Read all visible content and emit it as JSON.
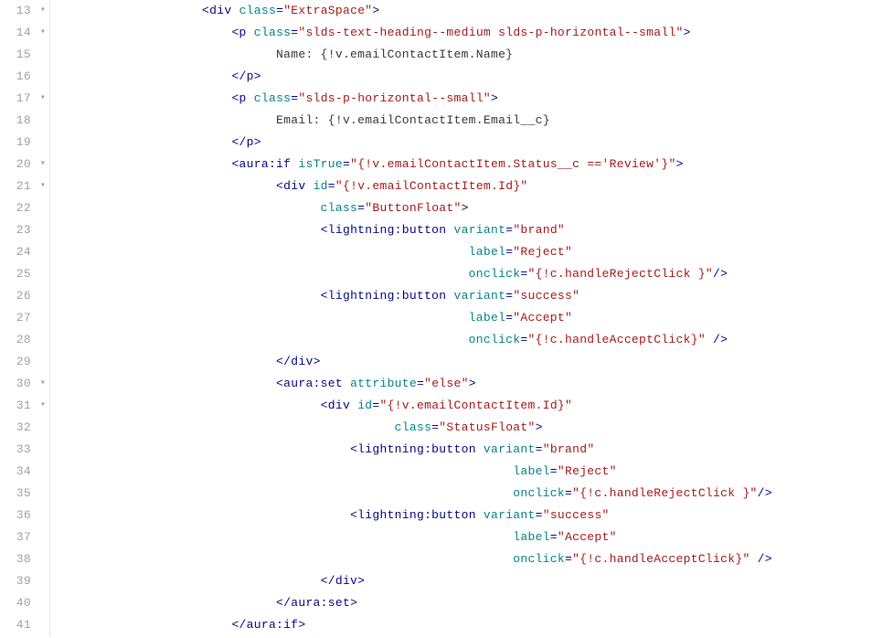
{
  "lines": [
    {
      "num": "13",
      "fold": "▾",
      "indent": 20,
      "tokens": [
        {
          "t": "pun",
          "v": "<"
        },
        {
          "t": "tag",
          "v": "div"
        },
        {
          "t": "text",
          "v": " "
        },
        {
          "t": "attr",
          "v": "class"
        },
        {
          "t": "pun",
          "v": "="
        },
        {
          "t": "str",
          "v": "\"ExtraSpace\""
        },
        {
          "t": "pun",
          "v": ">"
        }
      ]
    },
    {
      "num": "14",
      "fold": "▾",
      "indent": 24,
      "tokens": [
        {
          "t": "pun",
          "v": "<"
        },
        {
          "t": "tag",
          "v": "p"
        },
        {
          "t": "text",
          "v": " "
        },
        {
          "t": "attr",
          "v": "class"
        },
        {
          "t": "pun",
          "v": "="
        },
        {
          "t": "str",
          "v": "\"slds-text-heading--medium slds-p-horizontal--small\""
        },
        {
          "t": "pun",
          "v": ">"
        }
      ]
    },
    {
      "num": "15",
      "fold": "",
      "indent": 30,
      "tokens": [
        {
          "t": "text",
          "v": "Name: {!v.emailContactItem.Name}"
        }
      ]
    },
    {
      "num": "16",
      "fold": "",
      "indent": 24,
      "tokens": [
        {
          "t": "pun",
          "v": "</"
        },
        {
          "t": "tag",
          "v": "p"
        },
        {
          "t": "pun",
          "v": ">"
        }
      ]
    },
    {
      "num": "17",
      "fold": "▾",
      "indent": 24,
      "tokens": [
        {
          "t": "pun",
          "v": "<"
        },
        {
          "t": "tag",
          "v": "p"
        },
        {
          "t": "text",
          "v": " "
        },
        {
          "t": "attr",
          "v": "class"
        },
        {
          "t": "pun",
          "v": "="
        },
        {
          "t": "str",
          "v": "\"slds-p-horizontal--small\""
        },
        {
          "t": "pun",
          "v": ">"
        }
      ]
    },
    {
      "num": "18",
      "fold": "",
      "indent": 30,
      "tokens": [
        {
          "t": "text",
          "v": "Email: {!v.emailContactItem.Email__c}"
        }
      ]
    },
    {
      "num": "19",
      "fold": "",
      "indent": 24,
      "tokens": [
        {
          "t": "pun",
          "v": "</"
        },
        {
          "t": "tag",
          "v": "p"
        },
        {
          "t": "pun",
          "v": ">"
        }
      ]
    },
    {
      "num": "20",
      "fold": "▾",
      "indent": 24,
      "tokens": [
        {
          "t": "pun",
          "v": "<"
        },
        {
          "t": "tag",
          "v": "aura:if"
        },
        {
          "t": "text",
          "v": " "
        },
        {
          "t": "attr",
          "v": "isTrue"
        },
        {
          "t": "pun",
          "v": "="
        },
        {
          "t": "str",
          "v": "\"{!v.emailContactItem.Status__c =='Review'}\""
        },
        {
          "t": "pun",
          "v": ">"
        }
      ]
    },
    {
      "num": "21",
      "fold": "▾",
      "indent": 30,
      "tokens": [
        {
          "t": "pun",
          "v": "<"
        },
        {
          "t": "tag",
          "v": "div"
        },
        {
          "t": "text",
          "v": " "
        },
        {
          "t": "attr",
          "v": "id"
        },
        {
          "t": "pun",
          "v": "="
        },
        {
          "t": "str",
          "v": "\"{!v.emailContactItem.Id}\""
        }
      ]
    },
    {
      "num": "22",
      "fold": "",
      "indent": 36,
      "tokens": [
        {
          "t": "attr",
          "v": "class"
        },
        {
          "t": "pun",
          "v": "="
        },
        {
          "t": "str",
          "v": "\"ButtonFloat\""
        },
        {
          "t": "pun",
          "v": ">"
        }
      ]
    },
    {
      "num": "23",
      "fold": "",
      "indent": 36,
      "tokens": [
        {
          "t": "pun",
          "v": "<"
        },
        {
          "t": "tag",
          "v": "lightning:button"
        },
        {
          "t": "text",
          "v": " "
        },
        {
          "t": "attr",
          "v": "variant"
        },
        {
          "t": "pun",
          "v": "="
        },
        {
          "t": "str",
          "v": "\"brand\""
        }
      ]
    },
    {
      "num": "24",
      "fold": "",
      "indent": 56,
      "tokens": [
        {
          "t": "attr",
          "v": "label"
        },
        {
          "t": "pun",
          "v": "="
        },
        {
          "t": "str",
          "v": "\"Reject\""
        }
      ]
    },
    {
      "num": "25",
      "fold": "",
      "indent": 56,
      "tokens": [
        {
          "t": "attr",
          "v": "onclick"
        },
        {
          "t": "pun",
          "v": "="
        },
        {
          "t": "str",
          "v": "\"{!c.handleRejectClick }\""
        },
        {
          "t": "pun",
          "v": "/>"
        }
      ]
    },
    {
      "num": "26",
      "fold": "",
      "indent": 36,
      "tokens": [
        {
          "t": "pun",
          "v": "<"
        },
        {
          "t": "tag",
          "v": "lightning:button"
        },
        {
          "t": "text",
          "v": " "
        },
        {
          "t": "attr",
          "v": "variant"
        },
        {
          "t": "pun",
          "v": "="
        },
        {
          "t": "str",
          "v": "\"success\""
        }
      ]
    },
    {
      "num": "27",
      "fold": "",
      "indent": 56,
      "tokens": [
        {
          "t": "attr",
          "v": "label"
        },
        {
          "t": "pun",
          "v": "="
        },
        {
          "t": "str",
          "v": "\"Accept\""
        }
      ]
    },
    {
      "num": "28",
      "fold": "",
      "indent": 56,
      "tokens": [
        {
          "t": "attr",
          "v": "onclick"
        },
        {
          "t": "pun",
          "v": "="
        },
        {
          "t": "str",
          "v": "\"{!c.handleAcceptClick}\""
        },
        {
          "t": "text",
          "v": " "
        },
        {
          "t": "pun",
          "v": "/>"
        }
      ]
    },
    {
      "num": "29",
      "fold": "",
      "indent": 30,
      "tokens": [
        {
          "t": "pun",
          "v": "</"
        },
        {
          "t": "tag",
          "v": "div"
        },
        {
          "t": "pun",
          "v": ">"
        }
      ]
    },
    {
      "num": "30",
      "fold": "▾",
      "indent": 30,
      "tokens": [
        {
          "t": "pun",
          "v": "<"
        },
        {
          "t": "tag",
          "v": "aura:set"
        },
        {
          "t": "text",
          "v": " "
        },
        {
          "t": "attr",
          "v": "attribute"
        },
        {
          "t": "pun",
          "v": "="
        },
        {
          "t": "str",
          "v": "\"else\""
        },
        {
          "t": "pun",
          "v": ">"
        }
      ]
    },
    {
      "num": "31",
      "fold": "▾",
      "indent": 36,
      "tokens": [
        {
          "t": "pun",
          "v": "<"
        },
        {
          "t": "tag",
          "v": "div"
        },
        {
          "t": "text",
          "v": " "
        },
        {
          "t": "attr",
          "v": "id"
        },
        {
          "t": "pun",
          "v": "="
        },
        {
          "t": "str",
          "v": "\"{!v.emailContactItem.Id}\""
        }
      ]
    },
    {
      "num": "32",
      "fold": "",
      "indent": 46,
      "tokens": [
        {
          "t": "attr",
          "v": "class"
        },
        {
          "t": "pun",
          "v": "="
        },
        {
          "t": "str",
          "v": "\"StatusFloat\""
        },
        {
          "t": "pun",
          "v": ">"
        }
      ]
    },
    {
      "num": "33",
      "fold": "",
      "indent": 40,
      "tokens": [
        {
          "t": "pun",
          "v": "<"
        },
        {
          "t": "tag",
          "v": "lightning:button"
        },
        {
          "t": "text",
          "v": " "
        },
        {
          "t": "attr",
          "v": "variant"
        },
        {
          "t": "pun",
          "v": "="
        },
        {
          "t": "str",
          "v": "\"brand\""
        }
      ]
    },
    {
      "num": "34",
      "fold": "",
      "indent": 62,
      "tokens": [
        {
          "t": "attr",
          "v": "label"
        },
        {
          "t": "pun",
          "v": "="
        },
        {
          "t": "str",
          "v": "\"Reject\""
        }
      ]
    },
    {
      "num": "35",
      "fold": "",
      "indent": 62,
      "tokens": [
        {
          "t": "attr",
          "v": "onclick"
        },
        {
          "t": "pun",
          "v": "="
        },
        {
          "t": "str",
          "v": "\"{!c.handleRejectClick }\""
        },
        {
          "t": "pun",
          "v": "/>"
        }
      ]
    },
    {
      "num": "36",
      "fold": "",
      "indent": 40,
      "tokens": [
        {
          "t": "pun",
          "v": "<"
        },
        {
          "t": "tag",
          "v": "lightning:button"
        },
        {
          "t": "text",
          "v": " "
        },
        {
          "t": "attr",
          "v": "variant"
        },
        {
          "t": "pun",
          "v": "="
        },
        {
          "t": "str",
          "v": "\"success\""
        }
      ]
    },
    {
      "num": "37",
      "fold": "",
      "indent": 62,
      "tokens": [
        {
          "t": "attr",
          "v": "label"
        },
        {
          "t": "pun",
          "v": "="
        },
        {
          "t": "str",
          "v": "\"Accept\""
        }
      ]
    },
    {
      "num": "38",
      "fold": "",
      "indent": 62,
      "tokens": [
        {
          "t": "attr",
          "v": "onclick"
        },
        {
          "t": "pun",
          "v": "="
        },
        {
          "t": "str",
          "v": "\"{!c.handleAcceptClick}\""
        },
        {
          "t": "text",
          "v": " "
        },
        {
          "t": "pun",
          "v": "/>"
        }
      ]
    },
    {
      "num": "39",
      "fold": "",
      "indent": 36,
      "tokens": [
        {
          "t": "pun",
          "v": "</"
        },
        {
          "t": "tag",
          "v": "div"
        },
        {
          "t": "pun",
          "v": ">"
        }
      ]
    },
    {
      "num": "40",
      "fold": "",
      "indent": 30,
      "tokens": [
        {
          "t": "pun",
          "v": "</"
        },
        {
          "t": "tag",
          "v": "aura:set"
        },
        {
          "t": "pun",
          "v": ">"
        }
      ]
    },
    {
      "num": "41",
      "fold": "",
      "indent": 24,
      "tokens": [
        {
          "t": "pun",
          "v": "</"
        },
        {
          "t": "tag",
          "v": "aura:if"
        },
        {
          "t": "pun",
          "v": ">"
        }
      ]
    }
  ]
}
